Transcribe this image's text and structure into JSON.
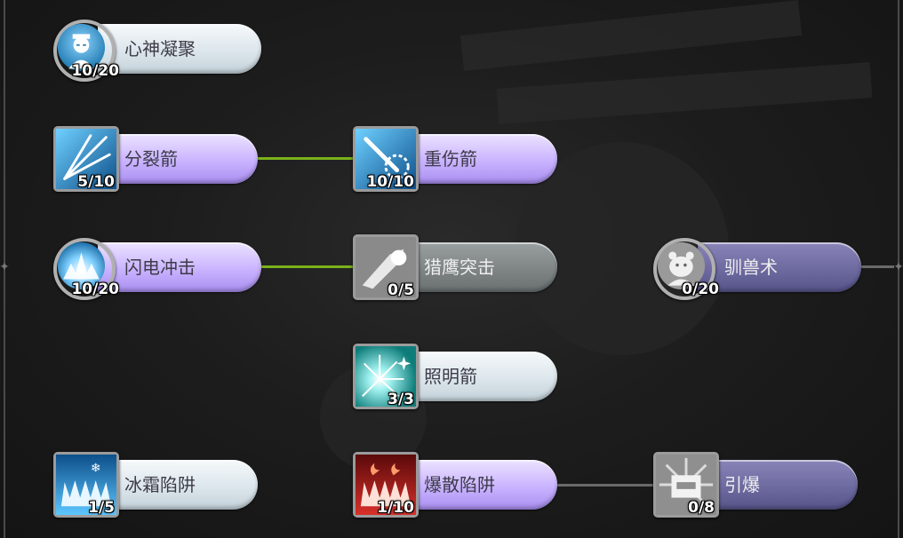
{
  "skills": [
    {
      "name": "心神凝聚",
      "level": "10/20"
    },
    {
      "name": "分裂箭",
      "level": "5/10"
    },
    {
      "name": "重伤箭",
      "level": "10/10"
    },
    {
      "name": "闪电冲击",
      "level": "10/20"
    },
    {
      "name": "猎鹰突击",
      "level": "0/5"
    },
    {
      "name": "驯兽术",
      "level": "0/20"
    },
    {
      "name": "照明箭",
      "level": "3/3"
    },
    {
      "name": "冰霜陷阱",
      "level": "1/5"
    },
    {
      "name": "爆散陷阱",
      "level": "1/10"
    },
    {
      "name": "引爆",
      "level": "0/8"
    }
  ],
  "colors": {
    "connector_active": "#7ab21a",
    "connector_inactive": "#6a6a6a",
    "pill_unlocked": "#dce6ec",
    "pill_upgradable": "#c9b3ff",
    "pill_locked": "#7f8585",
    "pill_locked_far": "#6d6aa0"
  },
  "icons": [
    "monk-icon",
    "split-arrow-icon",
    "heavy-arrow-icon",
    "lightning-burst-icon",
    "falcon-strike-icon",
    "beast-taming-icon",
    "flare-arrow-icon",
    "frost-trap-icon",
    "explosive-trap-icon",
    "tnt-detonate-icon"
  ]
}
